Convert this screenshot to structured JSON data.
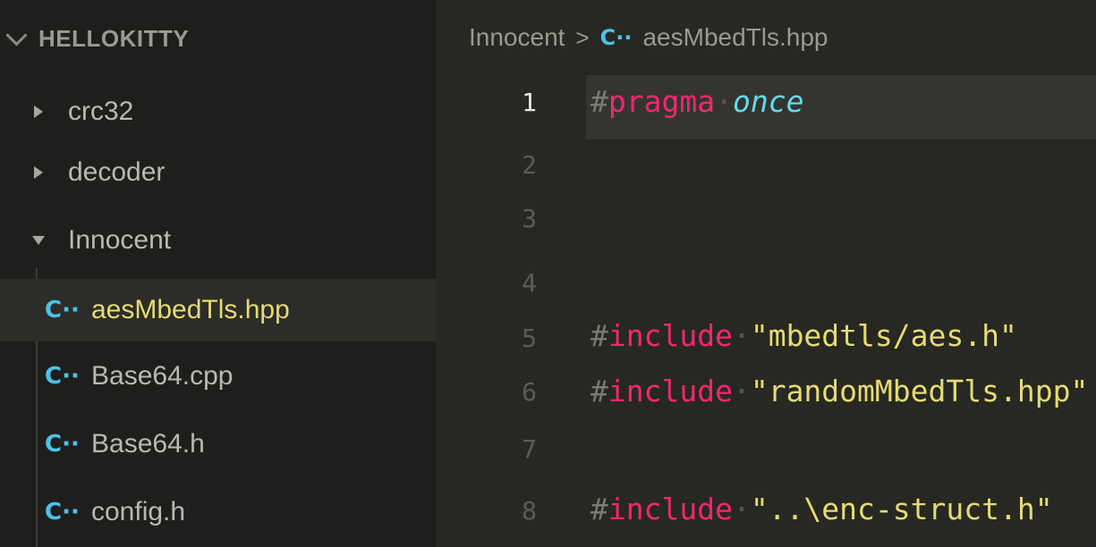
{
  "colors": {
    "editor_bg": "#272822",
    "sidebar_bg": "#1e1f1c",
    "keyword": "#f92672",
    "string": "#e6db74",
    "italic_keyword": "#66d9ef",
    "file_icon": "#4fc1e9"
  },
  "explorer": {
    "title": "HELLOKITTY",
    "items": [
      {
        "label": "crc32",
        "type": "folder",
        "expanded": false
      },
      {
        "label": "decoder",
        "type": "folder",
        "expanded": false
      },
      {
        "label": "Innocent",
        "type": "folder",
        "expanded": true
      },
      {
        "label": "aesMbedTls.hpp",
        "type": "file",
        "icon": "cpp-file-icon",
        "selected": true
      },
      {
        "label": "Base64.cpp",
        "type": "file",
        "icon": "cpp-file-icon"
      },
      {
        "label": "Base64.h",
        "type": "file",
        "icon": "cpp-file-icon"
      },
      {
        "label": "config.h",
        "type": "file",
        "icon": "cpp-file-icon"
      }
    ]
  },
  "breadcrumb": {
    "folder": "Innocent",
    "separator": ">",
    "file": "aesMbedTls.hpp"
  },
  "icon_glyph": "C··",
  "editor": {
    "lines": [
      {
        "number": "1",
        "hash": "#",
        "keyword": "pragma",
        "sep": "·",
        "arg": "once",
        "arg_type": "identifier"
      },
      {
        "number": "2"
      },
      {
        "number": "3"
      },
      {
        "number": "4"
      },
      {
        "number": "5",
        "hash": "#",
        "keyword": "include",
        "sep": "·",
        "arg": "\"mbedtls/aes.h\"",
        "arg_type": "string"
      },
      {
        "number": "6",
        "hash": "#",
        "keyword": "include",
        "sep": "·",
        "arg": "\"randomMbedTls.hpp\"",
        "arg_type": "string"
      },
      {
        "number": "7"
      },
      {
        "number": "8",
        "hash": "#",
        "keyword": "include",
        "sep": "·",
        "arg": "\"..\\enc-struct.h\"",
        "arg_type": "string"
      }
    ]
  }
}
